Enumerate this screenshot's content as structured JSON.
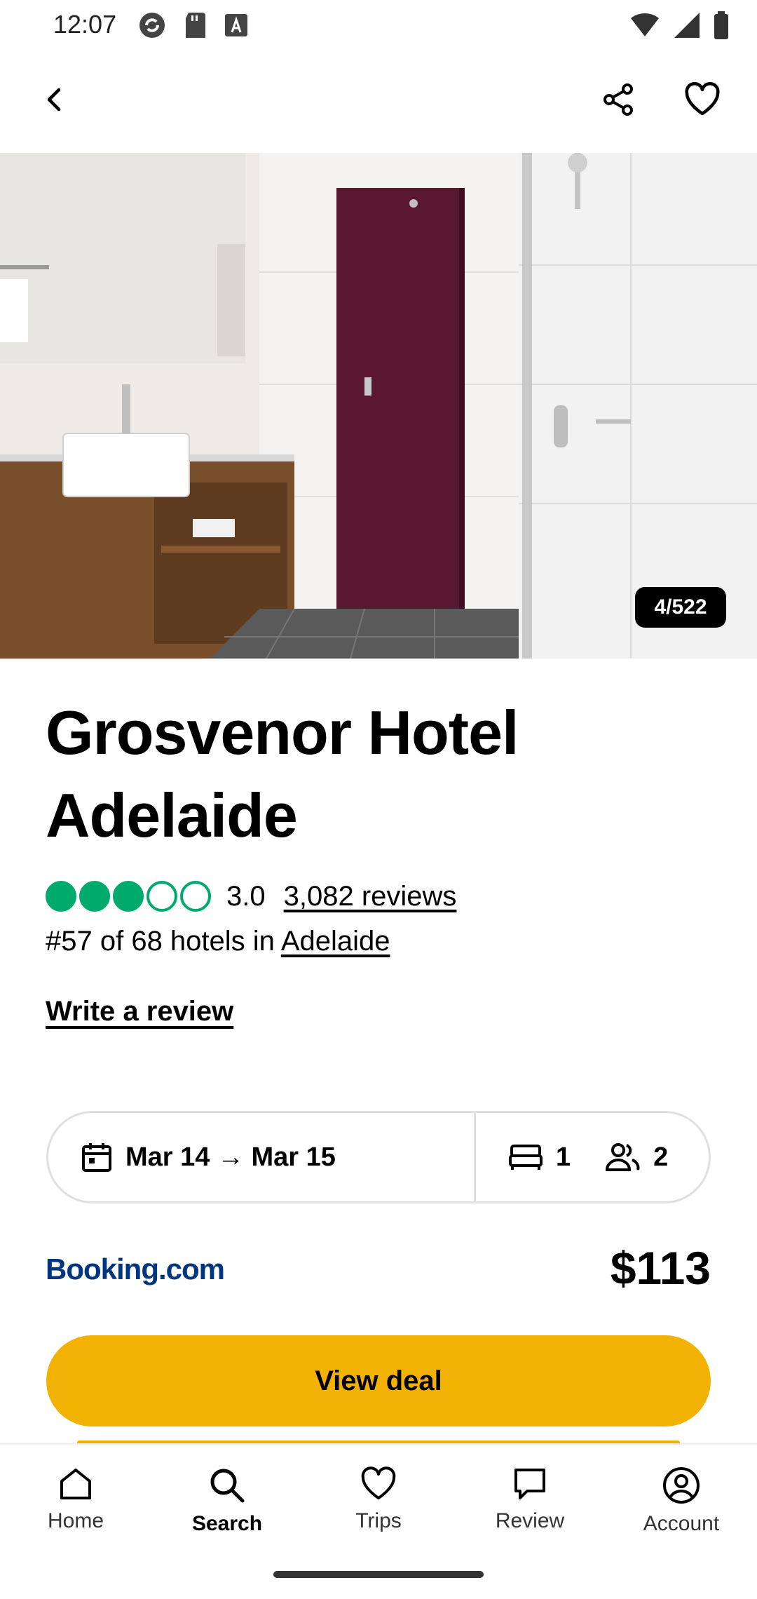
{
  "status_bar": {
    "time": "12:07"
  },
  "gallery": {
    "counter": "4/522"
  },
  "hotel": {
    "name": "Grosvenor Hotel Adelaide",
    "rating_value": "3.0",
    "rating_bubbles_filled": 3,
    "rating_bubbles_total": 5,
    "reviews_link": "3,082 reviews",
    "rank_text": "#57 of 68 hotels in ",
    "rank_city": "Adelaide",
    "write_review": "Write a review"
  },
  "booking": {
    "dates": "Mar 14 → Mar 15",
    "rooms": "1",
    "guests": "2"
  },
  "offer": {
    "provider": "Booking.com",
    "price": "$113",
    "cta": "View deal"
  },
  "bottom_nav": {
    "items": [
      {
        "label": "Home"
      },
      {
        "label": "Search"
      },
      {
        "label": "Trips"
      },
      {
        "label": "Review"
      },
      {
        "label": "Account"
      }
    ],
    "active": "Search"
  },
  "colors": {
    "rating_green": "#00aa6c",
    "cta_yellow": "#f2b203",
    "provider_blue": "#003580"
  }
}
